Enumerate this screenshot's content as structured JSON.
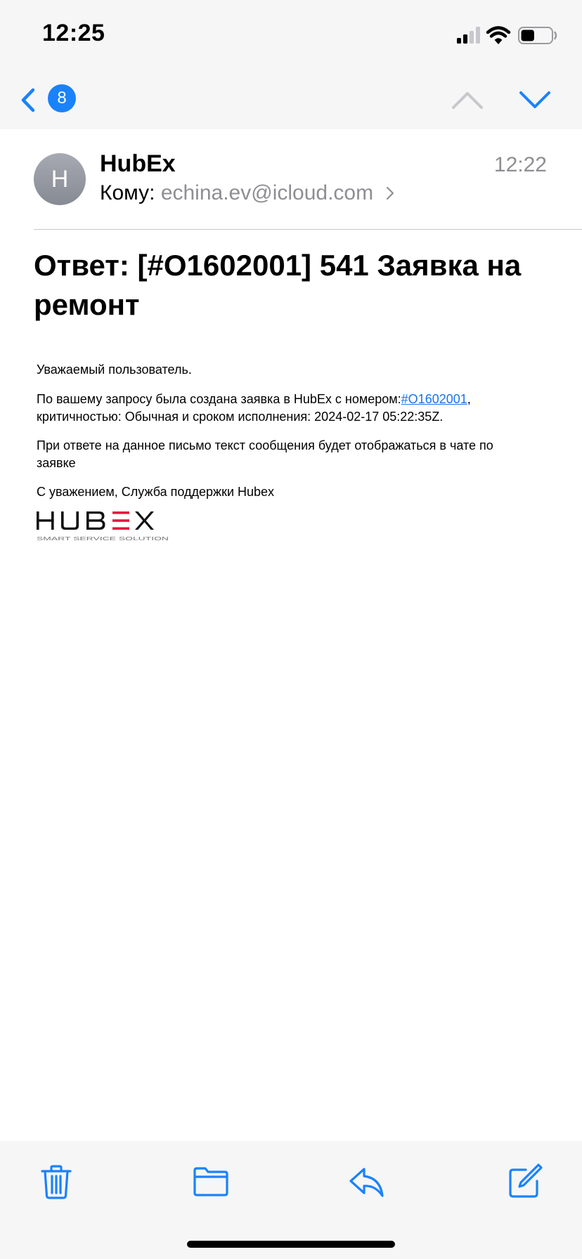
{
  "status_bar": {
    "time": "12:25",
    "battery_level": 0.45
  },
  "nav": {
    "unread_count": "8",
    "accent_color": "#1a82fb"
  },
  "message": {
    "avatar_initial": "H",
    "sender": "HubEx",
    "time": "12:22",
    "to_label": "Кому:",
    "to_address": "echina.ev@icloud.com",
    "subject": "Ответ: [#O1602001] 541 Заявка на ремонт",
    "body": {
      "greeting": "Уважаемый пользователь.",
      "p1_before": "По вашему запросу была создана заявка в HubEx с номером:",
      "p1_link": "#O1602001",
      "p1_after": ", критичностью: Обычная и сроком исполнения: 2024-02-17 05:22:35Z.",
      "p2": "При ответе на данное письмо текст сообщения будет отображаться в чате по заявке",
      "signature": "С уважением, Служба поддержки Hubex"
    },
    "logo": {
      "text": "HUBEX",
      "tagline": "SMART SERVICE SOLUTION"
    }
  },
  "toolbar": {
    "icons": [
      "trash-icon",
      "folder-icon",
      "reply-icon",
      "compose-icon"
    ]
  }
}
